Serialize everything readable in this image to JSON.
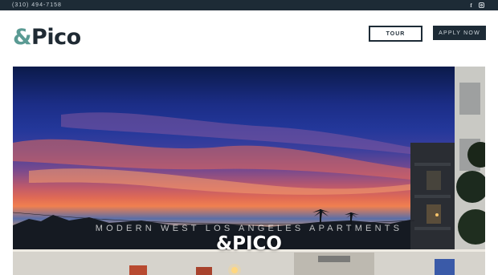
{
  "topbar": {
    "phone": "(310) 494-7158",
    "social": [
      {
        "icon": "facebook-icon",
        "glyph": "f"
      },
      {
        "icon": "instagram-icon"
      }
    ]
  },
  "header": {
    "logo_amp": "&",
    "logo_name": "Pico",
    "tour_label": "TOUR",
    "apply_label": "APPLY NOW"
  },
  "hero": {
    "tagline": "Modern West Los Angeles Apartments",
    "title": "&PICO"
  },
  "colors": {
    "navy": "#1d2b36",
    "teal": "#5a9a93"
  }
}
